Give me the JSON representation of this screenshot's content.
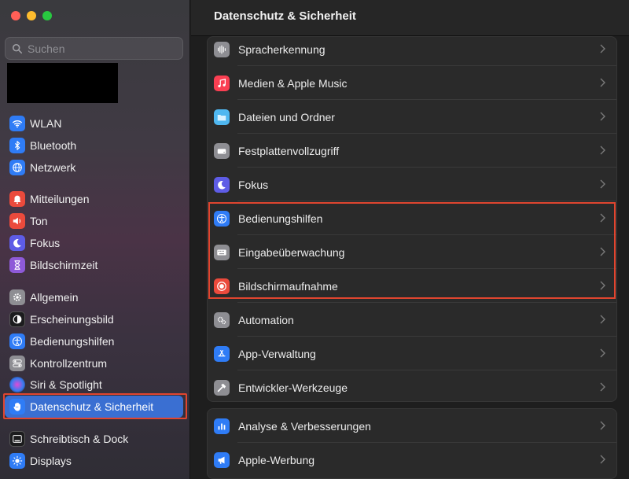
{
  "window": {
    "title": "Datenschutz & Sicherheit"
  },
  "search": {
    "placeholder": "Suchen"
  },
  "sidebar": {
    "items": [
      {
        "label": "WLAN",
        "icon": "wifi-icon",
        "color": "#2f7cf6"
      },
      {
        "label": "Bluetooth",
        "icon": "bluetooth-icon",
        "color": "#2f7cf6"
      },
      {
        "label": "Netzwerk",
        "icon": "globe-icon",
        "color": "#2f7cf6"
      },
      {
        "label": "Mitteilungen",
        "icon": "bell-icon",
        "color": "#eb4a3c"
      },
      {
        "label": "Ton",
        "icon": "speaker-icon",
        "color": "#eb4a3c"
      },
      {
        "label": "Fokus",
        "icon": "moon-icon",
        "color": "#5e5ce6"
      },
      {
        "label": "Bildschirmzeit",
        "icon": "hourglass-icon",
        "color": "#8e5ad8"
      },
      {
        "label": "Allgemein",
        "icon": "gear-icon",
        "color": "#8e8e93"
      },
      {
        "label": "Erscheinungsbild",
        "icon": "appearance-icon",
        "color": "#1c1c1e"
      },
      {
        "label": "Bedienungshilfen",
        "icon": "accessibility-icon",
        "color": "#2f7cf6"
      },
      {
        "label": "Kontrollzentrum",
        "icon": "toggles-icon",
        "color": "#8e8e93"
      },
      {
        "label": "Siri & Spotlight",
        "icon": "siri-icon",
        "color": "#3a3a8c"
      },
      {
        "label": "Datenschutz & Sicherheit",
        "icon": "hand-icon",
        "color": "#2f7cf6",
        "selected": true
      },
      {
        "label": "Schreibtisch & Dock",
        "icon": "dock-icon",
        "color": "#1c1c1e"
      },
      {
        "label": "Displays",
        "icon": "sun-icon",
        "color": "#2f7cf6"
      }
    ]
  },
  "main": {
    "group1": [
      {
        "label": "Spracherkennung",
        "icon": "waveform-icon",
        "color": "#8e8e93"
      },
      {
        "label": "Medien & Apple Music",
        "icon": "music-icon",
        "color": "#fa3f52"
      },
      {
        "label": "Dateien und Ordner",
        "icon": "folder-icon",
        "color": "#4fb7f0"
      },
      {
        "label": "Festplattenvollzugriff",
        "icon": "disk-icon",
        "color": "#8e8e93"
      },
      {
        "label": "Fokus",
        "icon": "moon-icon",
        "color": "#5e5ce6"
      },
      {
        "label": "Bedienungshilfen",
        "icon": "accessibility-icon",
        "color": "#2f7cf6"
      },
      {
        "label": "Eingabeüberwachung",
        "icon": "keyboard-icon",
        "color": "#8e8e93"
      },
      {
        "label": "Bildschirmaufnahme",
        "icon": "record-icon",
        "color": "#eb4a3c"
      },
      {
        "label": "Automation",
        "icon": "gears-icon",
        "color": "#8e8e93"
      },
      {
        "label": "App-Verwaltung",
        "icon": "appstore-icon",
        "color": "#2f7cf6"
      },
      {
        "label": "Entwickler-Werkzeuge",
        "icon": "hammer-icon",
        "color": "#8e8e93"
      }
    ],
    "group2": [
      {
        "label": "Analyse & Verbesserungen",
        "icon": "chart-icon",
        "color": "#2f7cf6"
      },
      {
        "label": "Apple-Werbung",
        "icon": "megaphone-icon",
        "color": "#2f7cf6"
      }
    ]
  }
}
